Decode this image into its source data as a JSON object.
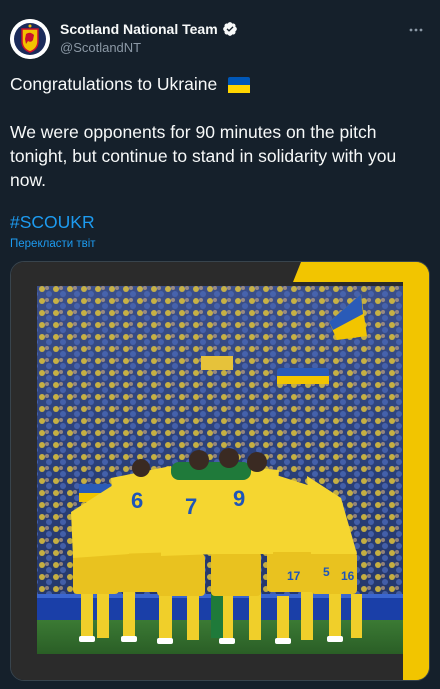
{
  "author": {
    "name": "Scotland National Team",
    "handle": "@ScotlandNT",
    "verified": true,
    "avatar_icon": "scotland-crest-icon"
  },
  "tweet": {
    "line1": "Congratulations to Ukraine",
    "flag_icon": "ukraine-flag-icon",
    "line2": "We were opponents for 90 minutes on the pitch tonight, but continue to stand in solidarity with you now.",
    "hashtag": "#SCOUKR",
    "translate_label": "Перекласти твіт"
  },
  "media": {
    "type": "photo",
    "description_icon": "team-huddle-photo",
    "jersey_numbers": [
      "6",
      "7",
      "9",
      "17",
      "5",
      "16"
    ]
  },
  "colors": {
    "background": "#15202b",
    "text": "#f7f9f9",
    "muted": "#8b98a5",
    "link": "#1d9bf0",
    "ukraine_blue": "#0057b7",
    "ukraine_yellow": "#ffd500"
  }
}
